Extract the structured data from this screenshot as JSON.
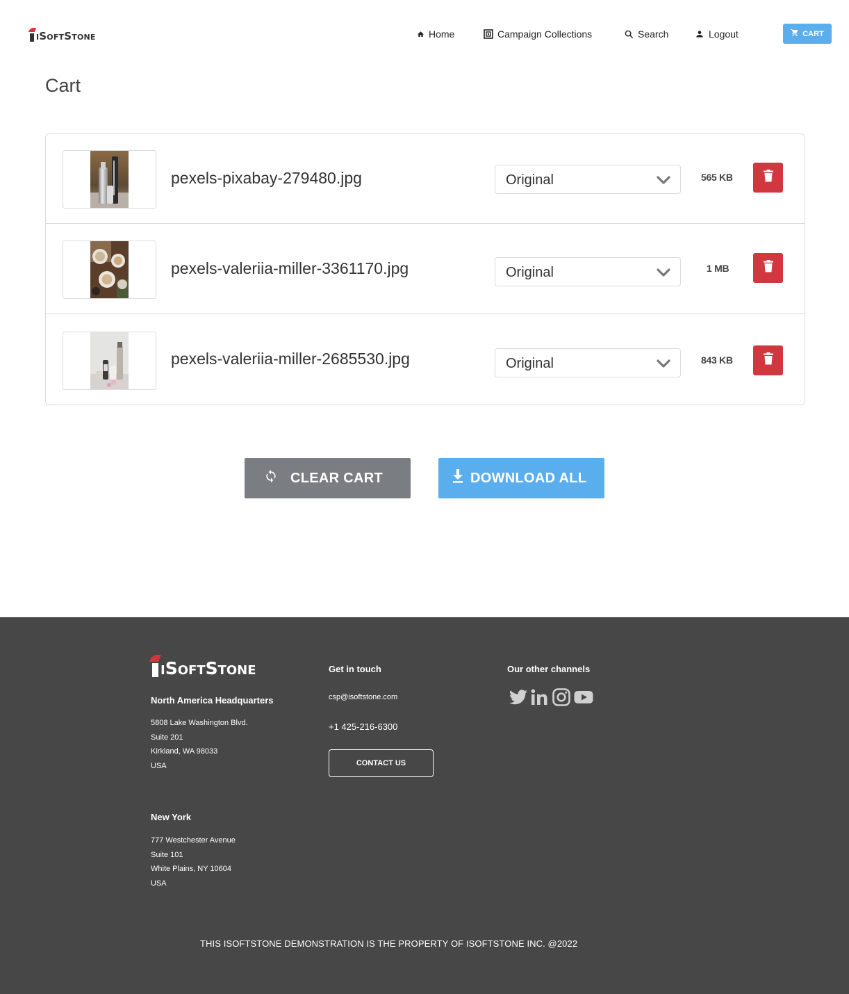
{
  "header": {
    "logo_text": "iSoftStone",
    "nav": {
      "home": "Home",
      "campaign": "Campaign Collections",
      "search": "Search",
      "logout": "Logout"
    },
    "cart_label": "CART"
  },
  "page_title": "Cart",
  "cart": {
    "items": [
      {
        "filename": "pexels-pixabay-279480.jpg",
        "variant": "Original",
        "size": "565 KB",
        "thumbnail": "bottles-on-table"
      },
      {
        "filename": "pexels-valeriia-miller-3361170.jpg",
        "variant": "Original",
        "size": "1 MB",
        "thumbnail": "coffee-cups-top-view"
      },
      {
        "filename": "pexels-valeriia-miller-2685530.jpg",
        "variant": "Original",
        "size": "843 KB",
        "thumbnail": "cosmetic-products-with-flowers"
      }
    ]
  },
  "actions": {
    "clear_cart": "CLEAR CART",
    "download_all": "DOWNLOAD ALL"
  },
  "footer": {
    "logo_text": "iSoftStone",
    "hq_title": "North America Headquarters",
    "hq_address": [
      "5808 Lake Washington Blvd.",
      "Suite 201",
      "Kirkland, WA 98033",
      "USA"
    ],
    "ny_title": "New York",
    "ny_address": [
      "777 Westchester Avenue",
      "Suite 101",
      "White Plains, NY 10604",
      "USA"
    ],
    "touch_title": "Get in touch",
    "email": "csp@isoftstone.com",
    "phone": "+1 425-216-6300",
    "contact_label": "CONTACT US",
    "channels_title": "Our other channels",
    "channels": [
      "twitter-icon",
      "linkedin-icon",
      "instagram-icon",
      "youtube-icon"
    ],
    "copyright": "THIS ISOFTSTONE DEMONSTRATION IS THE PROPERTY OF ISOFTSTONE INC. @2022"
  },
  "colors": {
    "accent": "#5aaeee",
    "danger": "#d0373f",
    "neutral_button": "#7a7d82",
    "footer_bg": "#474747",
    "brand_red": "#d9333a"
  }
}
